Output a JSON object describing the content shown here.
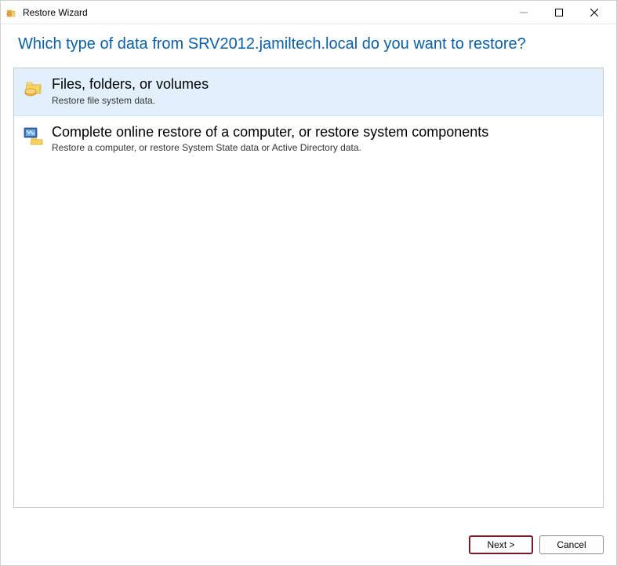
{
  "window": {
    "title": "Restore Wizard"
  },
  "heading": "Which type of data from SRV2012.jamiltech.local do you want to restore?",
  "options": [
    {
      "title": "Files, folders, or volumes",
      "desc": "Restore file system data."
    },
    {
      "title": "Complete online restore of a computer, or restore system components",
      "desc": "Restore a computer, or restore System State data or Active Directory data."
    }
  ],
  "footer": {
    "next": "Next >",
    "cancel": "Cancel"
  }
}
